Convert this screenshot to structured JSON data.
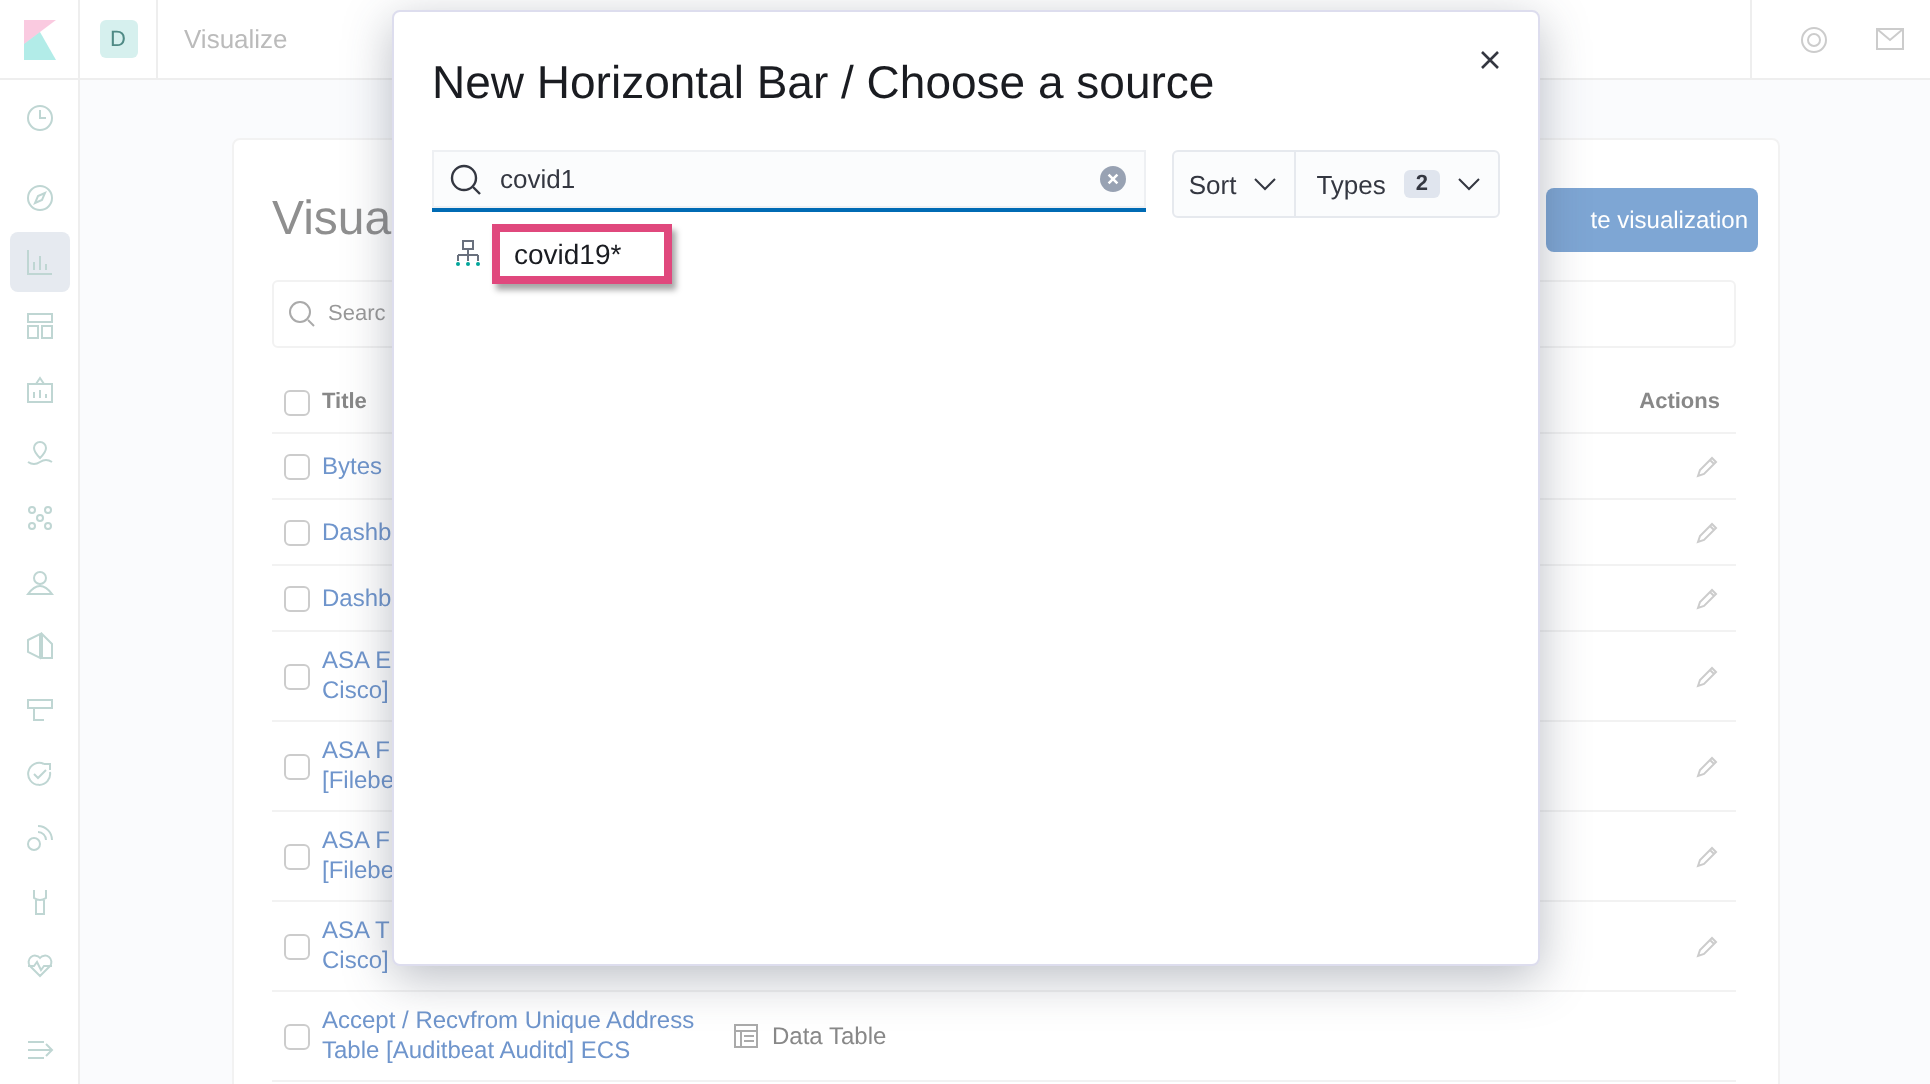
{
  "header": {
    "avatar": "D",
    "breadcrumb": "Visualize"
  },
  "sidebar": {
    "items": [
      {
        "kind": "clock",
        "selected": false
      },
      {
        "kind": "compass",
        "selected": false
      },
      {
        "kind": "chart",
        "selected": true
      },
      {
        "kind": "dashboard",
        "selected": false
      },
      {
        "kind": "canvas",
        "selected": false
      },
      {
        "kind": "map",
        "selected": false
      },
      {
        "kind": "ml",
        "selected": false
      },
      {
        "kind": "user",
        "selected": false
      },
      {
        "kind": "shapes",
        "selected": false
      },
      {
        "kind": "apm",
        "selected": false
      },
      {
        "kind": "uptime",
        "selected": false
      },
      {
        "kind": "signal",
        "selected": false
      },
      {
        "kind": "wrench",
        "selected": false
      },
      {
        "kind": "heart",
        "selected": false
      },
      {
        "kind": "collapse",
        "selected": false
      }
    ]
  },
  "page": {
    "title": "Visua",
    "create_button": "te visualization",
    "search": {
      "placeholder": "Searc"
    },
    "table": {
      "columns": [
        "Title",
        "Actions"
      ],
      "select_all_checked": false,
      "rows": [
        {
          "title": [
            "Bytes"
          ],
          "checked": false
        },
        {
          "title": [
            "Dashb"
          ],
          "checked": false
        },
        {
          "title": [
            "Dashb"
          ],
          "checked": false
        },
        {
          "title": [
            "ASA E",
            "Cisco]"
          ],
          "checked": false
        },
        {
          "title": [
            "ASA F",
            "[Filebe"
          ],
          "checked": false
        },
        {
          "title": [
            "ASA F",
            "[Filebe"
          ],
          "checked": false
        },
        {
          "title": [
            "ASA T",
            "Cisco]"
          ],
          "checked": false
        },
        {
          "title": [
            "Accept / Recvfrom Unique Address",
            "Table [Auditbeat Auditd] ECS"
          ],
          "type": "Data Table",
          "checked": false
        }
      ]
    }
  },
  "modal": {
    "title": "New Horizontal Bar / Choose a source",
    "search": {
      "value": "covid1"
    },
    "sort": "Sort",
    "types": {
      "label": "Types",
      "count": "2"
    },
    "results": [
      {
        "label": "covid19*",
        "highlighted": true
      }
    ]
  }
}
